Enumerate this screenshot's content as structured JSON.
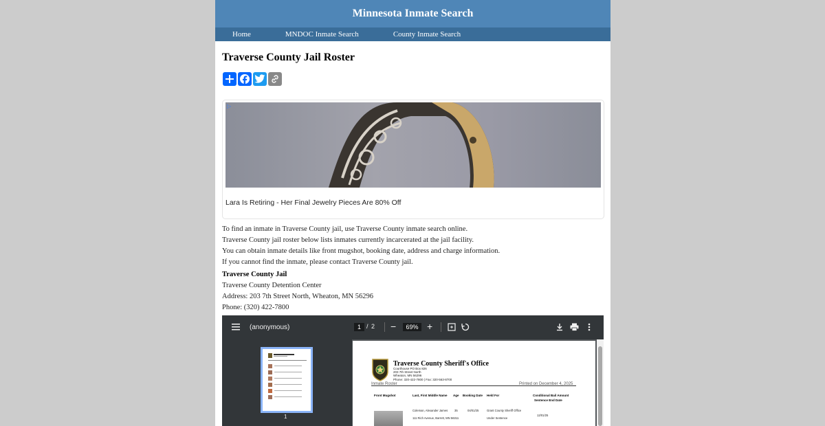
{
  "site": {
    "title": "Minnesota Inmate Search"
  },
  "nav": {
    "items": [
      {
        "label": "Home"
      },
      {
        "label": "MNDOC Inmate Search"
      },
      {
        "label": "County Inmate Search"
      }
    ]
  },
  "page": {
    "title": "Traverse County Jail Roster"
  },
  "share": {
    "icons": [
      "plus-icon",
      "facebook-icon",
      "twitter-icon",
      "copy-link-icon"
    ]
  },
  "ad": {
    "headline": "Lara Is Retiring - Her Final Jewelry Pieces Are 80% Off",
    "flag": "▷"
  },
  "intro": [
    "To find an inmate in Traverse County jail, use Traverse County inmate search online.",
    "Traverse County jail roster below lists inmates currently incarcerated at the jail facility.",
    "You can obtain inmate details like front mugshot, booking date, address and charge information.",
    "If you cannot find the inmate, please contact Traverse County jail."
  ],
  "jail": {
    "name": "Traverse County Jail",
    "facility": "Traverse County Detention Center",
    "address": "Address: 203 7th Street North, Wheaton, MN 56296",
    "phone": "Phone: (320) 422-7800"
  },
  "pdf": {
    "file_title": "(anonymous)",
    "current_page": "1",
    "separator": "/",
    "total_pages": "2",
    "zoom": "69%",
    "thumb_label": "1",
    "doc": {
      "office": "Traverse County Sheriff's Office",
      "address_lines": [
        "Courthouse PO Box 826",
        "203 7th Street North",
        "Wheaton, MN 56296",
        "Phone: 320-422-7800 | Fax: 320-563-8700"
      ],
      "roster_label": "Inmate Roster",
      "printed": "Printed on December 4, 2025",
      "columns": [
        "Front Mugshot",
        "Last, First Middle Name",
        "Age",
        "Booking Date",
        "Held For",
        "Conditional Bail Amount",
        "Sentence End Date"
      ],
      "row": {
        "name": "Coleman, Alexander James",
        "age": "35",
        "booking_date": "04/01/25",
        "held_for": "Grant County Sheriff Office",
        "address": "111 Rich Avenue, Barrett, MN 56311",
        "status": "Under Sentence",
        "end_date": "12/01/25"
      }
    }
  }
}
